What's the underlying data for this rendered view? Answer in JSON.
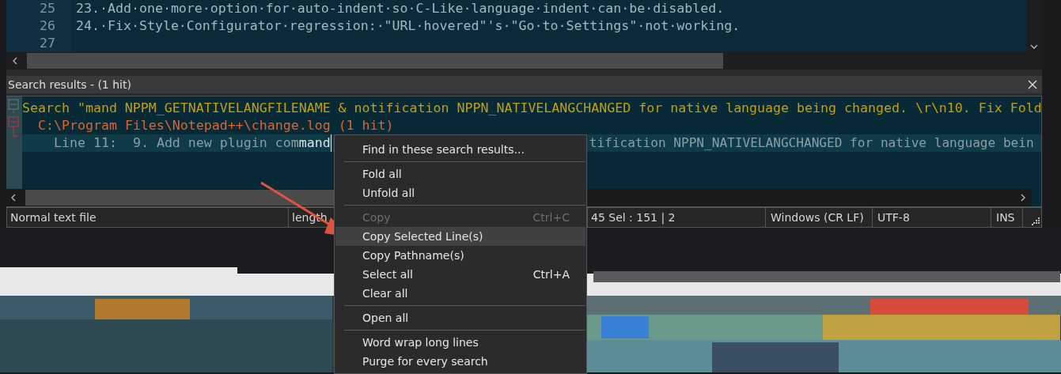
{
  "editor": {
    "lines": [
      {
        "number": "25",
        "text": "23.·Add·one·more·option·for·auto-indent·so·C-Like·language·indent·can·be·disabled."
      },
      {
        "number": "26",
        "text": "24.·Fix·Style·Configurator·regression:·\"URL·hovered\"'s·\"Go·to·Settings\"·not·working."
      },
      {
        "number": "27"
      }
    ]
  },
  "search_panel": {
    "title": "Search results - (1 hit)",
    "header": "Search \"mand NPPM_GETNATIVELANGFILENAME & notification NPPN_NATIVELANGCHANGED for native language being changed. \\r\\n10. Fix Fold",
    "file": "C:\\Program Files\\Notepad++\\change.log (1 hit)",
    "hit": {
      "prefix": "Line 11:",
      "text": "  9. Add new plugin com",
      "match": "mand",
      "tail": "tification NPPN_NATIVELANGCHANGED for native language bein"
    }
  },
  "status_bar": [
    "Normal text file",
    "length",
    "45   Sel : 151 | 2",
    "Windows (CR LF)",
    "UTF-8",
    "INS"
  ],
  "context_menu": {
    "items": [
      {
        "kind": "item",
        "label": "Find in these search results...",
        "disabled": false,
        "selected": false
      },
      {
        "kind": "separator"
      },
      {
        "kind": "item",
        "label": "Fold all",
        "disabled": false,
        "selected": false
      },
      {
        "kind": "item",
        "label": "Unfold all",
        "disabled": false,
        "selected": false
      },
      {
        "kind": "separator"
      },
      {
        "kind": "item",
        "label": "Copy",
        "shortcut": "Ctrl+C",
        "disabled": true,
        "selected": false
      },
      {
        "kind": "item",
        "label": "Copy Selected Line(s)",
        "disabled": false,
        "selected": true
      },
      {
        "kind": "item",
        "label": "Copy Pathname(s)",
        "disabled": false,
        "selected": false
      },
      {
        "kind": "item",
        "label": "Select all",
        "shortcut": "Ctrl+A",
        "disabled": false,
        "selected": false
      },
      {
        "kind": "item",
        "label": "Clear all",
        "disabled": false,
        "selected": false
      },
      {
        "kind": "separator"
      },
      {
        "kind": "item",
        "label": "Open all",
        "disabled": false,
        "selected": false
      },
      {
        "kind": "separator"
      },
      {
        "kind": "item",
        "label": "Word wrap long lines",
        "disabled": false,
        "selected": false
      },
      {
        "kind": "item",
        "label": "Purge for every search",
        "disabled": false,
        "selected": false
      }
    ]
  }
}
